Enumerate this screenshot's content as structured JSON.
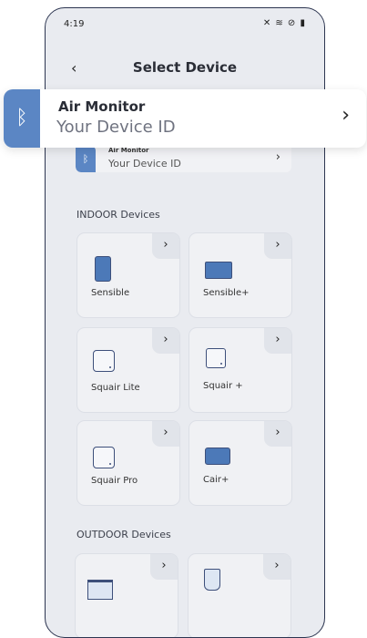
{
  "status_bar": {
    "time": "4:19",
    "icons": "✕ ≋ ⊘ ▮"
  },
  "header": {
    "back_glyph": "‹",
    "title": "Select Device"
  },
  "bluetooth_glyph": "ᛒ",
  "chevron_glyph": "›",
  "selected_device": {
    "name": "Air Monitor",
    "id_label": "Your Device ID"
  },
  "indoor": {
    "title": "INDOOR Devices",
    "devices": [
      {
        "label": "Sensible"
      },
      {
        "label": "Sensible+"
      },
      {
        "label": "Squair Lite"
      },
      {
        "label": "Squair +"
      },
      {
        "label": "Squair Pro"
      },
      {
        "label": "Cair+"
      }
    ]
  },
  "outdoor": {
    "title": "OUTDOOR Devices"
  },
  "colors": {
    "accent": "#5b86c4",
    "device_icon": "#4c79b8",
    "background": "#e9ebf0"
  }
}
